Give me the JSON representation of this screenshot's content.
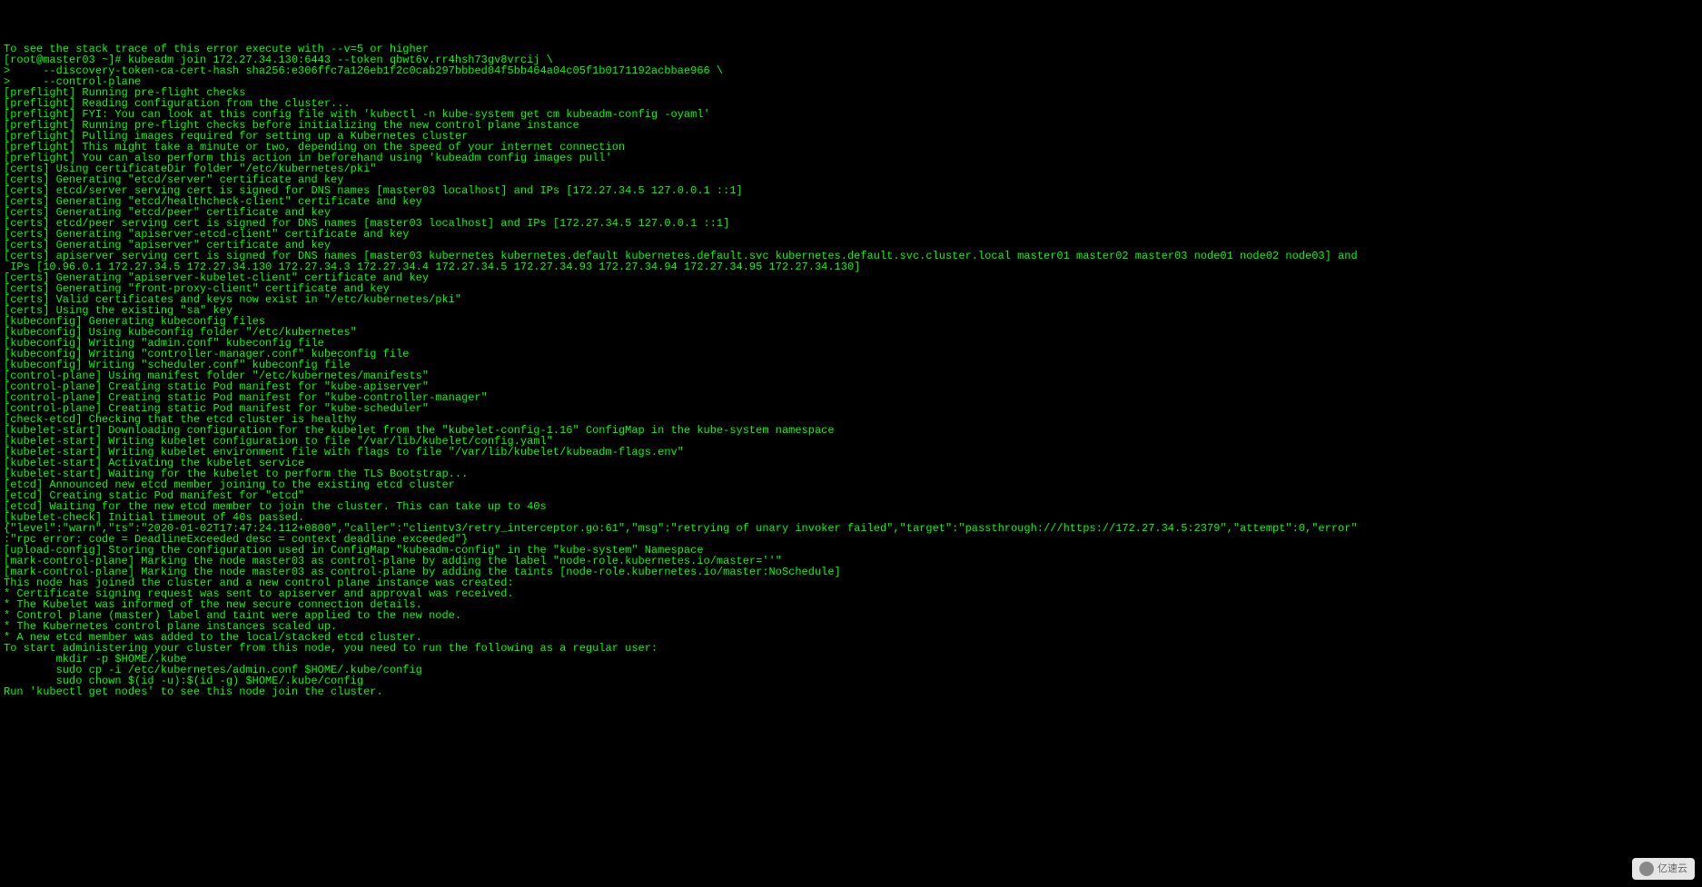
{
  "terminal": {
    "lines": [
      "To see the stack trace of this error execute with --v=5 or higher",
      "[root@master03 ~]# kubeadm join 172.27.34.130:6443 --token qbwt6v.rr4hsh73gv8vrcij \\",
      ">     --discovery-token-ca-cert-hash sha256:e306ffc7a126eb1f2c0cab297bbbed04f5bb464a04c05f1b0171192acbbae966 \\",
      ">     --control-plane",
      "[preflight] Running pre-flight checks",
      "[preflight] Reading configuration from the cluster...",
      "[preflight] FYI: You can look at this config file with 'kubectl -n kube-system get cm kubeadm-config -oyaml'",
      "[preflight] Running pre-flight checks before initializing the new control plane instance",
      "[preflight] Pulling images required for setting up a Kubernetes cluster",
      "[preflight] This might take a minute or two, depending on the speed of your internet connection",
      "[preflight] You can also perform this action in beforehand using 'kubeadm config images pull'",
      "[certs] Using certificateDir folder \"/etc/kubernetes/pki\"",
      "[certs] Generating \"etcd/server\" certificate and key",
      "[certs] etcd/server serving cert is signed for DNS names [master03 localhost] and IPs [172.27.34.5 127.0.0.1 ::1]",
      "[certs] Generating \"etcd/healthcheck-client\" certificate and key",
      "[certs] Generating \"etcd/peer\" certificate and key",
      "[certs] etcd/peer serving cert is signed for DNS names [master03 localhost] and IPs [172.27.34.5 127.0.0.1 ::1]",
      "[certs] Generating \"apiserver-etcd-client\" certificate and key",
      "[certs] Generating \"apiserver\" certificate and key",
      "[certs] apiserver serving cert is signed for DNS names [master03 kubernetes kubernetes.default kubernetes.default.svc kubernetes.default.svc.cluster.local master01 master02 master03 node01 node02 node03] and",
      " IPs [10.96.0.1 172.27.34.5 172.27.34.130 172.27.34.3 172.27.34.4 172.27.34.5 172.27.34.93 172.27.34.94 172.27.34.95 172.27.34.130]",
      "[certs] Generating \"apiserver-kubelet-client\" certificate and key",
      "[certs] Generating \"front-proxy-client\" certificate and key",
      "[certs] Valid certificates and keys now exist in \"/etc/kubernetes/pki\"",
      "[certs] Using the existing \"sa\" key",
      "[kubeconfig] Generating kubeconfig files",
      "[kubeconfig] Using kubeconfig folder \"/etc/kubernetes\"",
      "[kubeconfig] Writing \"admin.conf\" kubeconfig file",
      "[kubeconfig] Writing \"controller-manager.conf\" kubeconfig file",
      "[kubeconfig] Writing \"scheduler.conf\" kubeconfig file",
      "[control-plane] Using manifest folder \"/etc/kubernetes/manifests\"",
      "[control-plane] Creating static Pod manifest for \"kube-apiserver\"",
      "[control-plane] Creating static Pod manifest for \"kube-controller-manager\"",
      "[control-plane] Creating static Pod manifest for \"kube-scheduler\"",
      "[check-etcd] Checking that the etcd cluster is healthy",
      "[kubelet-start] Downloading configuration for the kubelet from the \"kubelet-config-1.16\" ConfigMap in the kube-system namespace",
      "[kubelet-start] Writing kubelet configuration to file \"/var/lib/kubelet/config.yaml\"",
      "[kubelet-start] Writing kubelet environment file with flags to file \"/var/lib/kubelet/kubeadm-flags.env\"",
      "[kubelet-start] Activating the kubelet service",
      "[kubelet-start] Waiting for the kubelet to perform the TLS Bootstrap...",
      "[etcd] Announced new etcd member joining to the existing etcd cluster",
      "[etcd] Creating static Pod manifest for \"etcd\"",
      "[etcd] Waiting for the new etcd member to join the cluster. This can take up to 40s",
      "[kubelet-check] Initial timeout of 40s passed.",
      "{\"level\":\"warn\",\"ts\":\"2020-01-02T17:47:24.112+0800\",\"caller\":\"clientv3/retry_interceptor.go:61\",\"msg\":\"retrying of unary invoker failed\",\"target\":\"passthrough:///https://172.27.34.5:2379\",\"attempt\":0,\"error\"",
      ":\"rpc error: code = DeadlineExceeded desc = context deadline exceeded\"}",
      "[upload-config] Storing the configuration used in ConfigMap \"kubeadm-config\" in the \"kube-system\" Namespace",
      "[mark-control-plane] Marking the node master03 as control-plane by adding the label \"node-role.kubernetes.io/master=''\"",
      "[mark-control-plane] Marking the node master03 as control-plane by adding the taints [node-role.kubernetes.io/master:NoSchedule]",
      "",
      "This node has joined the cluster and a new control plane instance was created:",
      "",
      "* Certificate signing request was sent to apiserver and approval was received.",
      "* The Kubelet was informed of the new secure connection details.",
      "* Control plane (master) label and taint were applied to the new node.",
      "* The Kubernetes control plane instances scaled up.",
      "* A new etcd member was added to the local/stacked etcd cluster.",
      "",
      "To start administering your cluster from this node, you need to run the following as a regular user:",
      "",
      "        mkdir -p $HOME/.kube",
      "        sudo cp -i /etc/kubernetes/admin.conf $HOME/.kube/config",
      "        sudo chown $(id -u):$(id -g) $HOME/.kube/config",
      "",
      "Run 'kubectl get nodes' to see this node join the cluster.",
      ""
    ]
  },
  "watermark": {
    "text": "亿速云"
  }
}
